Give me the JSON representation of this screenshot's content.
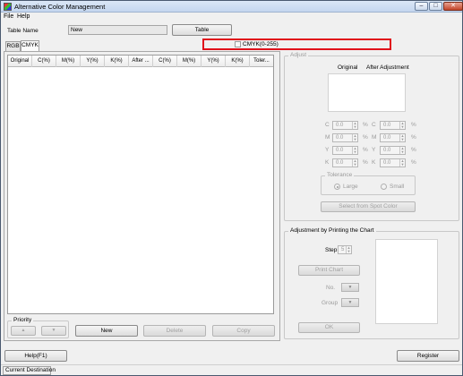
{
  "window": {
    "title": "Alternative Color Management",
    "min_icon": "minimize-icon",
    "max_icon": "maximize-icon",
    "close_icon": "close-icon"
  },
  "menu": {
    "file": "File",
    "help": "Help"
  },
  "table_name": {
    "label": "Table Name",
    "value": "New",
    "button": "Table"
  },
  "cmyk_checkbox": {
    "label": "CMYK(0-255)",
    "checked": false
  },
  "tabs": [
    "RGB",
    "CMYK"
  ],
  "grid": {
    "columns": [
      "Original",
      "C(%)",
      "M(%)",
      "Y(%)",
      "K(%)",
      "After ...",
      "C(%)",
      "M(%)",
      "Y(%)",
      "K(%)",
      "Toler..."
    ]
  },
  "priority": {
    "label": "Priority",
    "up": "▲",
    "down": "▼"
  },
  "list_buttons": {
    "new": "New",
    "delete": "Delete",
    "copy": "Copy"
  },
  "adjust": {
    "title": "Adjust",
    "original": "Original",
    "after": "After Adjustment",
    "channels": [
      "C",
      "M",
      "Y",
      "K"
    ],
    "value": "0.0",
    "unit": "%",
    "tolerance": {
      "title": "Tolerance",
      "large": "Large",
      "small": "Small",
      "selected": "Large"
    },
    "spot_button": "Select from Spot Color"
  },
  "chart": {
    "title": "Adjustment by Printing the Chart",
    "step_label": "Step",
    "step_value": "5",
    "print_button": "Print Chart",
    "no_label": "No.",
    "group_label": "Group",
    "ok_button": "OK"
  },
  "footer": {
    "help": "Help(F1)",
    "register": "Register"
  },
  "status": {
    "current_destination": "Current Destination"
  }
}
